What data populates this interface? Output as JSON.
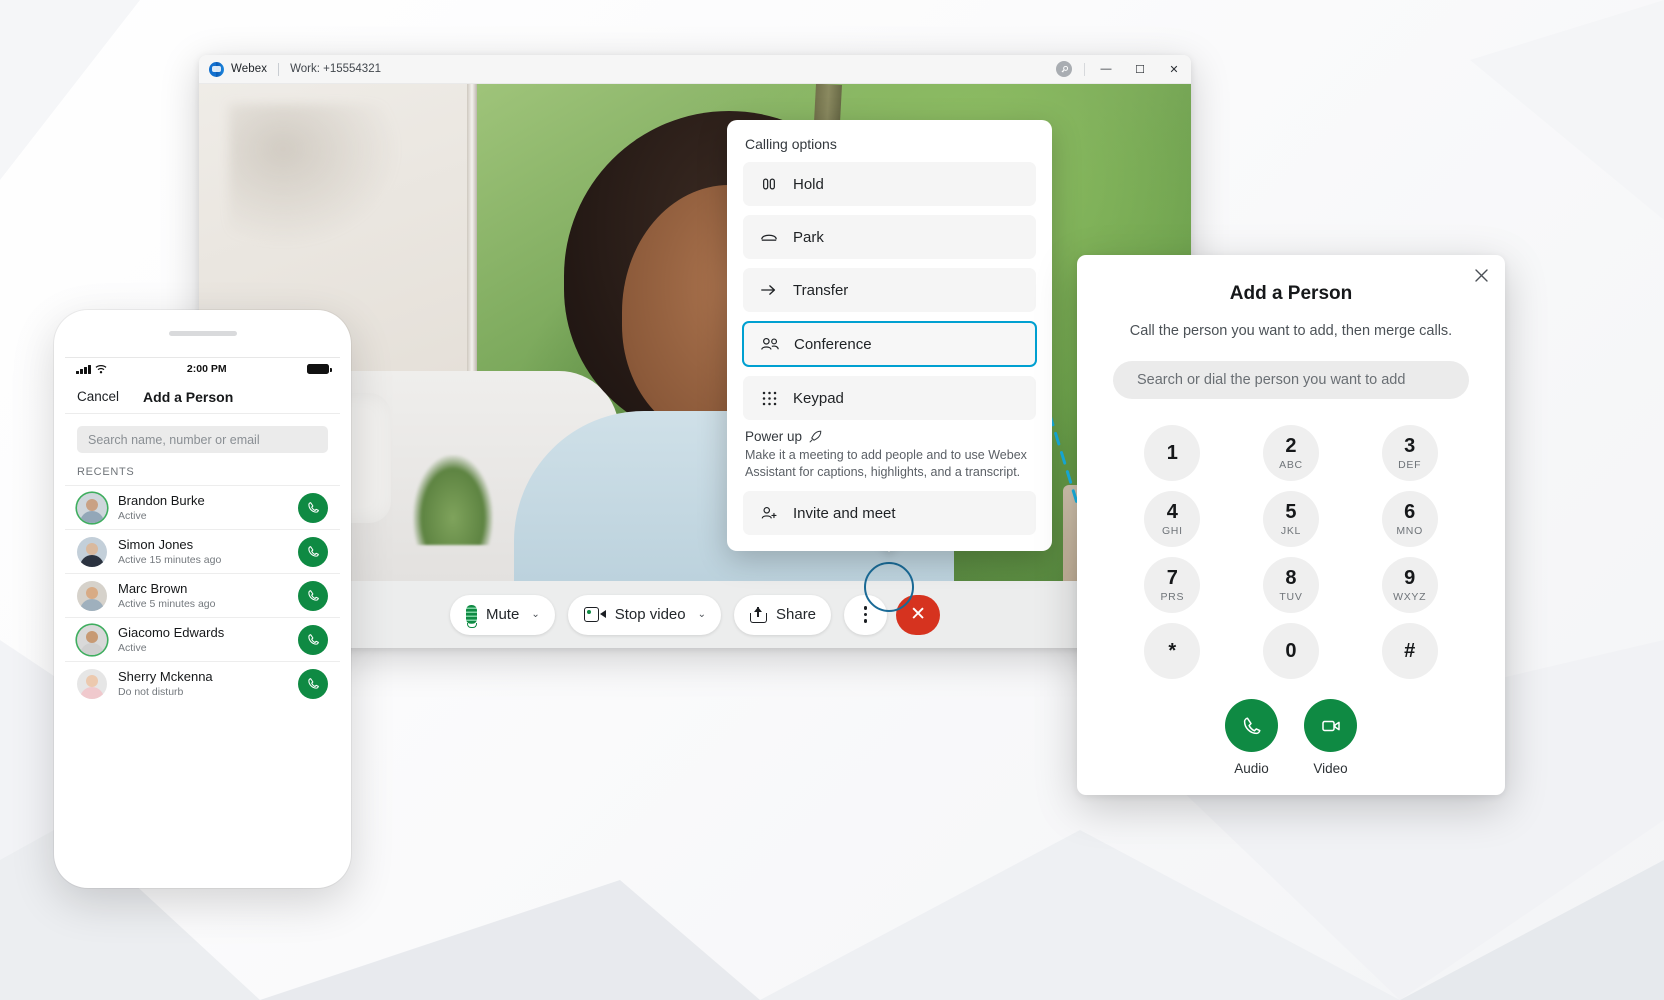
{
  "desktop_window": {
    "titlebar": {
      "logo_icon": "webex-logo-icon",
      "app_name": "Webex",
      "work_number": "Work: +15554321",
      "account_badge": "account-badge-icon",
      "minimize_label": "—",
      "maximize_label": "☐",
      "close_label": "✕"
    },
    "controls": {
      "mute": {
        "label": "Mute",
        "icon": "microphone-icon",
        "caret": "⌄"
      },
      "stop_video": {
        "label": "Stop video",
        "icon": "camera-icon",
        "caret": "⌄"
      },
      "share": {
        "label": "Share",
        "icon": "share-screen-icon"
      },
      "more": {
        "icon": "more-options-icon"
      },
      "end_call": {
        "icon": "end-call-icon",
        "glyph": "✕"
      }
    }
  },
  "calling_options": {
    "title": "Calling options",
    "items": [
      {
        "label": "Hold",
        "icon": "hold-icon",
        "selected": false
      },
      {
        "label": "Park",
        "icon": "park-icon",
        "selected": false
      },
      {
        "label": "Transfer",
        "icon": "transfer-arrow-icon",
        "selected": false
      },
      {
        "label": "Conference",
        "icon": "conference-people-icon",
        "selected": true
      },
      {
        "label": "Keypad",
        "icon": "keypad-dots-icon",
        "selected": false
      }
    ],
    "powerup_title": "Power up",
    "powerup_icon": "rocket-icon",
    "powerup_desc": "Make it a meeting to add people and to use Webex Assistant for captions, highlights, and a transcript.",
    "invite_and_meet": {
      "label": "Invite and meet",
      "icon": "add-person-icon"
    },
    "highlight_color": "#00a0d1"
  },
  "add_person_dialog": {
    "close_icon": "close-icon",
    "title": "Add a Person",
    "subtitle": "Call the person you want to add, then merge calls.",
    "search_placeholder": "Search or dial the person you want to add",
    "search_value": "",
    "keys": [
      {
        "digit": "1",
        "letters": ""
      },
      {
        "digit": "2",
        "letters": "ABC"
      },
      {
        "digit": "3",
        "letters": "DEF"
      },
      {
        "digit": "4",
        "letters": "GHI"
      },
      {
        "digit": "5",
        "letters": "JKL"
      },
      {
        "digit": "6",
        "letters": "MNO"
      },
      {
        "digit": "7",
        "letters": "PRS"
      },
      {
        "digit": "8",
        "letters": "TUV"
      },
      {
        "digit": "9",
        "letters": "WXYZ"
      },
      {
        "digit": "*",
        "letters": ""
      },
      {
        "digit": "0",
        "letters": ""
      },
      {
        "digit": "#",
        "letters": ""
      }
    ],
    "actions": [
      {
        "label": "Audio",
        "icon": "phone-handset-icon",
        "color": "#0f8a43"
      },
      {
        "label": "Video",
        "icon": "video-camera-icon",
        "color": "#0f8a43"
      }
    ]
  },
  "mobile": {
    "status_bar": {
      "signal_icon": "signal-bars-icon",
      "wifi_icon": "wifi-icon",
      "time": "2:00 PM",
      "battery_icon": "battery-icon"
    },
    "nav": {
      "cancel_label": "Cancel",
      "title": "Add a Person"
    },
    "search_placeholder": "Search name, number or email",
    "search_value": "",
    "section_label": "RECENTS",
    "recents": [
      {
        "name": "Brandon Burke",
        "status": "Active",
        "available": true,
        "skin": "#c9a184",
        "hair": "#2e2520",
        "shirt": "#93a7b8",
        "call_icon": "phone-handset-icon"
      },
      {
        "name": "Simon Jones",
        "status": "Active 15 minutes ago",
        "available": false,
        "skin": "#d9b99e",
        "hair": "#2b2320",
        "shirt": "#2b3340",
        "call_icon": "phone-handset-icon"
      },
      {
        "name": "Marc Brown",
        "status": "Active 5 minutes ago",
        "available": false,
        "skin": "#d8ab85",
        "hair": "#5e432c",
        "shirt": "#9fb0bd",
        "call_icon": "phone-handset-icon"
      },
      {
        "name": "Giacomo Edwards",
        "status": "Active",
        "available": true,
        "skin": "#c79a74",
        "hair": "#241c18",
        "shirt": "#cfcfcf",
        "call_icon": "phone-handset-icon"
      },
      {
        "name": "Sherry Mckenna",
        "status": "Do not disturb",
        "available": false,
        "skin": "#ecc9ae",
        "hair": "#e3d7b9",
        "shirt": "#f0c9cd",
        "call_icon": "phone-handset-icon"
      }
    ]
  }
}
